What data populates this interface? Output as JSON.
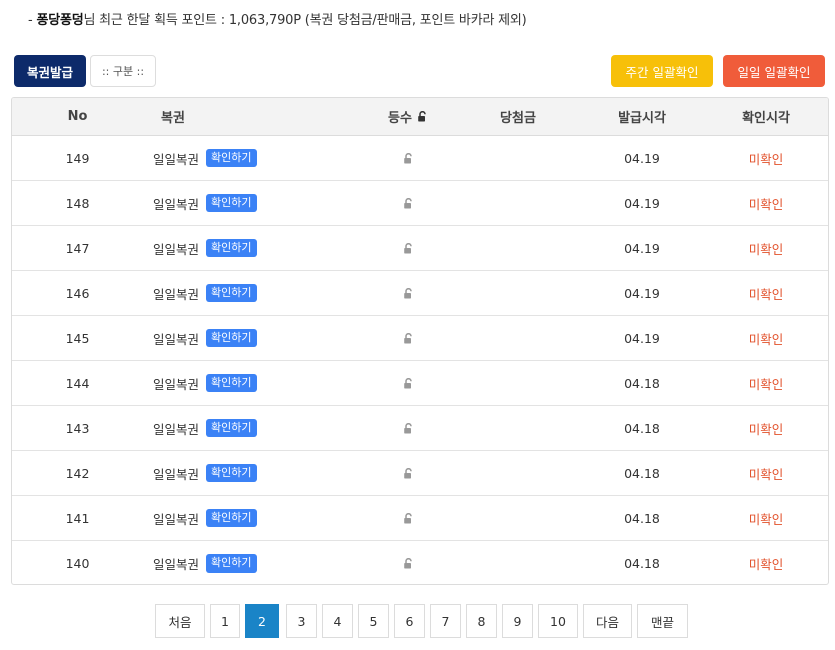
{
  "summary": {
    "prefix": "- ",
    "username": "퐁당퐁덩",
    "text": "님 최근 한달 획득 포인트 : 1,063,790P (복권 당첨금/판매금, 포인트 바카라 제외)"
  },
  "toolbar": {
    "issue_label": "복권발급",
    "category_label": ":: 구분 ::",
    "weekly_label": "주간 일괄확인",
    "daily_label": "일일 일괄확인"
  },
  "colors": {
    "issue": "#0d2a6a",
    "weekly": "#f7c009",
    "daily": "#f05c3a",
    "badge": "#3b82f6",
    "unchecked": "#e2522c",
    "page_active": "#1a84c7"
  },
  "table": {
    "headers": {
      "no": "No",
      "name": "복권",
      "grade": "등수",
      "prize": "당첨금",
      "issue_time": "발급시각",
      "check_time": "확인시각"
    },
    "rows": [
      {
        "no": "149",
        "name": "일일복권",
        "action": "확인하기",
        "prize": "",
        "issue_time": "04.19",
        "status": "미확인",
        "icon": "lock-open-icon"
      },
      {
        "no": "148",
        "name": "일일복권",
        "action": "확인하기",
        "prize": "",
        "issue_time": "04.19",
        "status": "미확인",
        "icon": "lock-open-icon"
      },
      {
        "no": "147",
        "name": "일일복권",
        "action": "확인하기",
        "prize": "",
        "issue_time": "04.19",
        "status": "미확인",
        "icon": "lock-open-icon"
      },
      {
        "no": "146",
        "name": "일일복권",
        "action": "확인하기",
        "prize": "",
        "issue_time": "04.19",
        "status": "미확인",
        "icon": "lock-open-icon"
      },
      {
        "no": "145",
        "name": "일일복권",
        "action": "확인하기",
        "prize": "",
        "issue_time": "04.19",
        "status": "미확인",
        "icon": "lock-open-icon"
      },
      {
        "no": "144",
        "name": "일일복권",
        "action": "확인하기",
        "prize": "",
        "issue_time": "04.18",
        "status": "미확인",
        "icon": "lock-open-icon"
      },
      {
        "no": "143",
        "name": "일일복권",
        "action": "확인하기",
        "prize": "",
        "issue_time": "04.18",
        "status": "미확인",
        "icon": "lock-open-icon"
      },
      {
        "no": "142",
        "name": "일일복권",
        "action": "확인하기",
        "prize": "",
        "issue_time": "04.18",
        "status": "미확인",
        "icon": "lock-open-icon"
      },
      {
        "no": "141",
        "name": "일일복권",
        "action": "확인하기",
        "prize": "",
        "issue_time": "04.18",
        "status": "미확인",
        "icon": "lock-open-icon"
      },
      {
        "no": "140",
        "name": "일일복권",
        "action": "확인하기",
        "prize": "",
        "issue_time": "04.18",
        "status": "미확인",
        "icon": "lock-open-icon"
      }
    ]
  },
  "pagination": {
    "first_label": "처음",
    "pages": [
      "1",
      "2",
      "3",
      "4",
      "5",
      "6",
      "7",
      "8",
      "9",
      "10"
    ],
    "current_page": "2",
    "next_label": "다음",
    "last_label": "맨끝"
  }
}
